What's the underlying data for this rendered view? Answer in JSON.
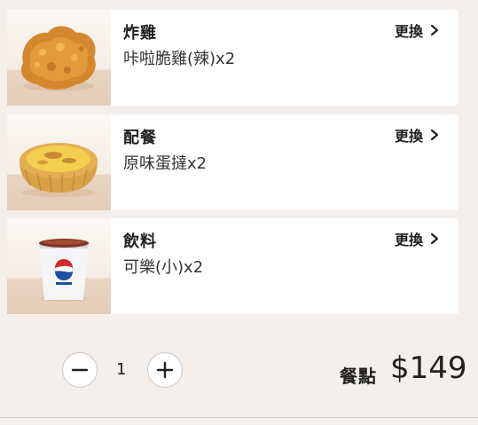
{
  "items": [
    {
      "title": "炸雞",
      "desc": "咔啦脆雞(辣)x2",
      "change_label": "更換",
      "icon": "fried-chicken-image"
    },
    {
      "title": "配餐",
      "desc": "原味蛋撻x2",
      "change_label": "更換",
      "icon": "egg-tart-image"
    },
    {
      "title": "飲料",
      "desc": "可樂(小)x2",
      "change_label": "更換",
      "icon": "pepsi-cup-image"
    }
  ],
  "quantity": "1",
  "price": {
    "label": "餐點",
    "value": "$149"
  },
  "colors": {
    "background": "#f4efeb",
    "card": "#ffffff",
    "text": "#202020"
  }
}
